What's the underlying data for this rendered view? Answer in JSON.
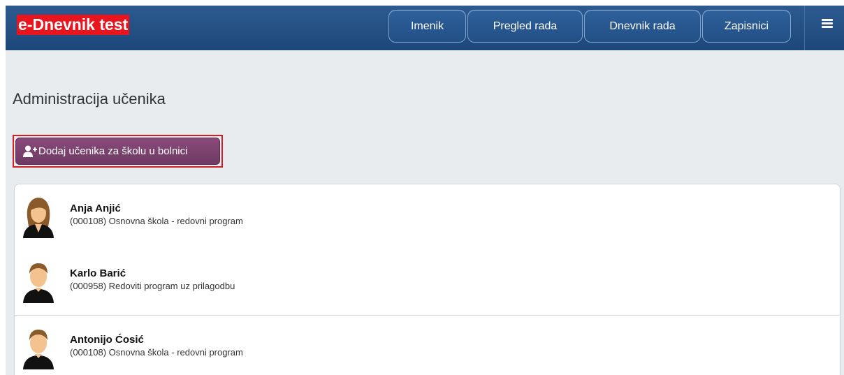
{
  "header": {
    "brand": "e-Dnevnik test",
    "nav": [
      {
        "label": "Imenik"
      },
      {
        "label": "Pregled rada"
      },
      {
        "label": "Dnevnik rada"
      },
      {
        "label": "Zapisnici"
      }
    ],
    "menu_icon": "hamburger-menu-icon"
  },
  "page": {
    "title": "Administracija učenika",
    "add_button_label": "Dodaj učenika za školu u bolnici",
    "add_button_icon": "add-user-icon"
  },
  "students": [
    {
      "name": "Anja Anjić",
      "detail": "(000108) Osnovna škola - redovni program",
      "avatar": "female-avatar-icon"
    },
    {
      "name": "Karlo Barić",
      "detail": "(000958) Redoviti program uz prilagodbu",
      "avatar": "male-avatar-icon"
    },
    {
      "name": "Antonijo Ćosić",
      "detail": "(000108) Osnovna škola - redovni program",
      "avatar": "male-avatar-icon"
    }
  ],
  "colors": {
    "header_bg": "#1d477a",
    "brand_bg": "#e8141e",
    "add_button_bg": "#7a4070",
    "highlight_border": "#d21f26",
    "page_bg": "#e9ecef"
  }
}
